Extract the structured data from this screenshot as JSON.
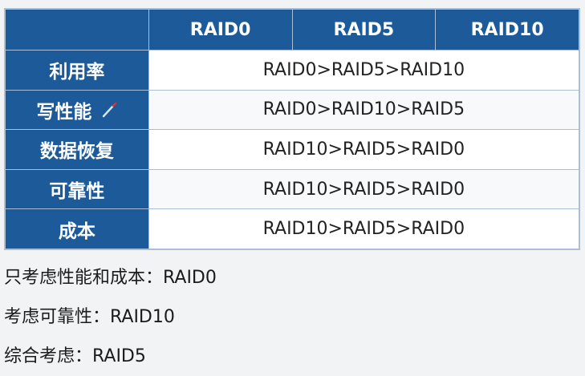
{
  "table": {
    "columns": [
      "RAID0",
      "RAID5",
      "RAID10"
    ],
    "rows": [
      {
        "label": "利用率",
        "value": "RAID0>RAID5>RAID10"
      },
      {
        "label": "写性能",
        "value": "RAID0>RAID10>RAID5"
      },
      {
        "label": "数据恢复",
        "value": "RAID10>RAID5>RAID0"
      },
      {
        "label": "可靠性",
        "value": "RAID10>RAID5>RAID0"
      },
      {
        "label": "成本",
        "value": "RAID10>RAID5>RAID0"
      }
    ]
  },
  "notes": [
    "只考虑性能和成本：RAID0",
    "考虑可靠性：RAID10",
    "综合考虑：RAID5"
  ],
  "icons": {
    "row2_annotation": "pen-icon"
  },
  "colors": {
    "header_bg": "#1d5a99",
    "header_text": "#ffffff",
    "border": "#a9bfd6"
  }
}
